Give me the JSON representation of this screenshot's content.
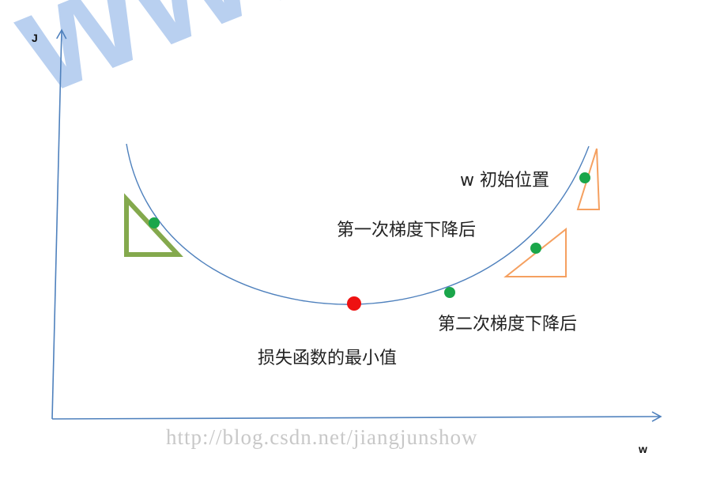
{
  "axes": {
    "y_label": "J",
    "x_label": "w"
  },
  "annotations": {
    "initial_position": "w 初始位置",
    "after_first_descent": "第一次梯度下降后",
    "after_second_descent": "第二次梯度下降后",
    "loss_minimum": "损失函数的最小值"
  },
  "watermarks": {
    "site": "www.captainbe",
    "url": "http://blog.csdn.net/jiangjunshow"
  },
  "colors": {
    "axis": "#4f81bd",
    "curve": "#4f81bd",
    "point_green": "#1aa64a",
    "point_red": "#ee1111",
    "triangle_orange": "#f5a060",
    "triangle_green": "#77a03a"
  }
}
